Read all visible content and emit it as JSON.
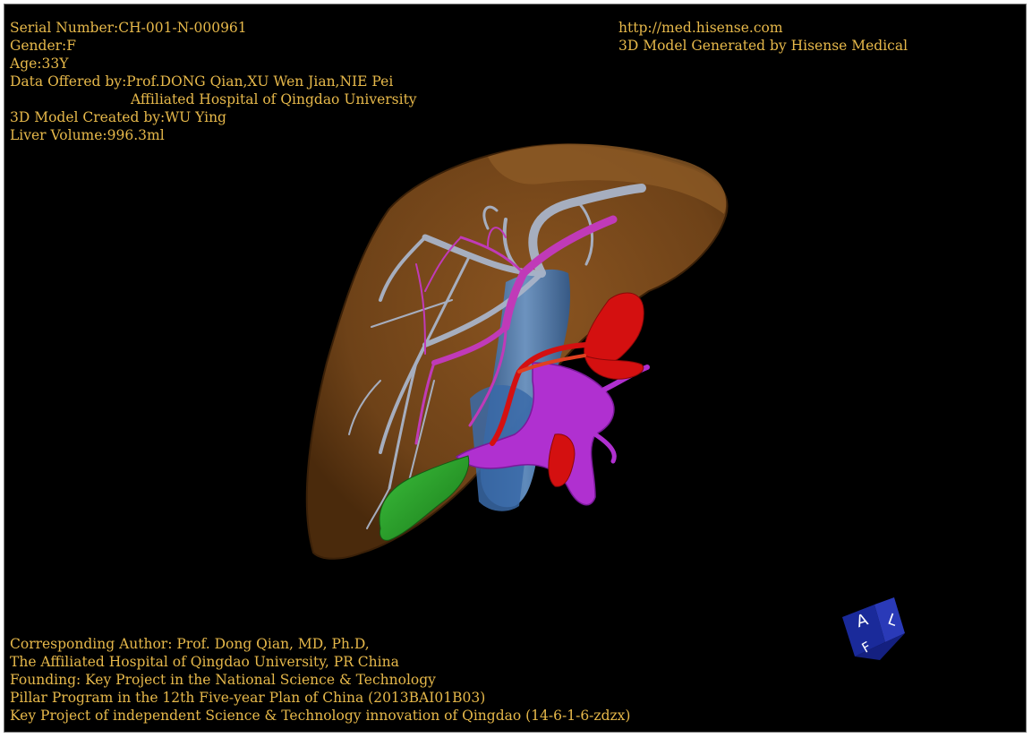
{
  "patient_info": {
    "serial_number": "Serial Number:CH-001-N-000961",
    "gender": "Gender:F",
    "age": "Age:33Y",
    "data_offered_by": "Data Offered by:Prof.DONG Qian,XU Wen Jian,NIE Pei",
    "hospital": "Affiliated Hospital of Qingdao University",
    "model_created_by": "3D Model Created by:WU Ying",
    "liver_volume": "Liver Volume:996.3ml"
  },
  "branding": {
    "url": "http://med.hisense.com",
    "generator": "3D Model Generated by Hisense Medical"
  },
  "credits": {
    "line1": "Corresponding Author: Prof. Dong Qian, MD, Ph.D,",
    "line2": "The Affiliated Hospital of Qingdao University, PR China",
    "line3": "Founding: Key Project in the National Science & Technology",
    "line4": "Pillar Program in the 12th Five-year Plan of China (2013BAI01B03)",
    "line5": "Key Project of independent Science & Technology innovation of Qingdao (14-6-1-6-zdzx)"
  },
  "orientation_cube": {
    "face_front": "A",
    "face_side": "L",
    "face_bottom": "F"
  },
  "colors": {
    "text": "#e6b84a",
    "liver": "#7a4a1c",
    "hepatic_vein": "#a9b4c8",
    "portal_vein": "#c03ab8",
    "artery": "#d41010",
    "ivc": "#4a78b0",
    "gallbladder": "#2ea82e",
    "portal_trunk": "#b030d0",
    "cube": "#1a2a9a"
  }
}
